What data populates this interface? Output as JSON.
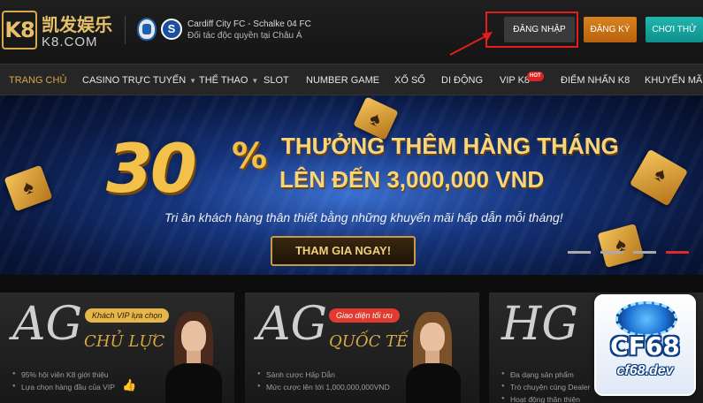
{
  "logo": {
    "mark": "K8",
    "chinese": "凯发娱乐",
    "domain": "K8.COM"
  },
  "partner": {
    "title": "Cardiff City FC - Schalke 04 FC",
    "subtitle": "Đối tác độc quyền tại Châu Á"
  },
  "header_buttons": {
    "login": "ĐĂNG NHẬP",
    "register": "ĐĂNG KÝ",
    "play": "CHƠI THỬ"
  },
  "colors": {
    "gold": "#d6a84a",
    "highlight": "#e41d1d",
    "register": "#c8721a",
    "play": "#1aa8a2"
  },
  "nav": {
    "items": [
      {
        "label": "TRANG CHỦ",
        "active": true
      },
      {
        "label": "CASINO TRỰC TUYẾN",
        "dropdown": true
      },
      {
        "label": "THỂ THAO",
        "dropdown": true
      },
      {
        "label": "SLOT"
      },
      {
        "label": "NUMBER GAME"
      },
      {
        "label": "XỔ SỐ"
      },
      {
        "label": "DI ĐỘNG"
      },
      {
        "label": "VIP K8",
        "badge": "HOT"
      },
      {
        "label": "ĐIỂM NHẤN K8"
      },
      {
        "label": "KHUYẾN MÃI"
      }
    ]
  },
  "banner": {
    "big_number": "30",
    "percent": "%",
    "headline1": "THƯỞNG THÊM HÀNG THÁNG",
    "headline2": "LÊN ĐẾN 3,000,000 VND",
    "subtitle": "Tri ân khách hàng thân thiết bằng những khuyến mãi hấp dẫn mỗi tháng!",
    "cta": "THAM GIA NGAY!",
    "slides": 4,
    "active_slide": 4
  },
  "tiles": [
    {
      "brand": "AG",
      "sub": "CHỦ LỰC",
      "tag": "Khách VIP lựa chọn",
      "features": [
        "95% hội viên K8 giới thiệu",
        "Lựa chọn hàng đầu của VIP"
      ]
    },
    {
      "brand": "AG",
      "sub": "QUỐC TẾ",
      "tag": "Giao diện tối ưu",
      "features": [
        "Sảnh cược Hấp Dẫn",
        "Mức cược lên tới 1,000,000,000VND"
      ]
    },
    {
      "brand": "HG",
      "sub": "",
      "tag": "",
      "features": [
        "Đa dạng sản phẩm",
        "Trò chuyện cùng Dealer",
        "Hoạt động thân thiện"
      ]
    }
  ],
  "watermark": {
    "logo": "CF68",
    "url": "cf68.dev"
  }
}
